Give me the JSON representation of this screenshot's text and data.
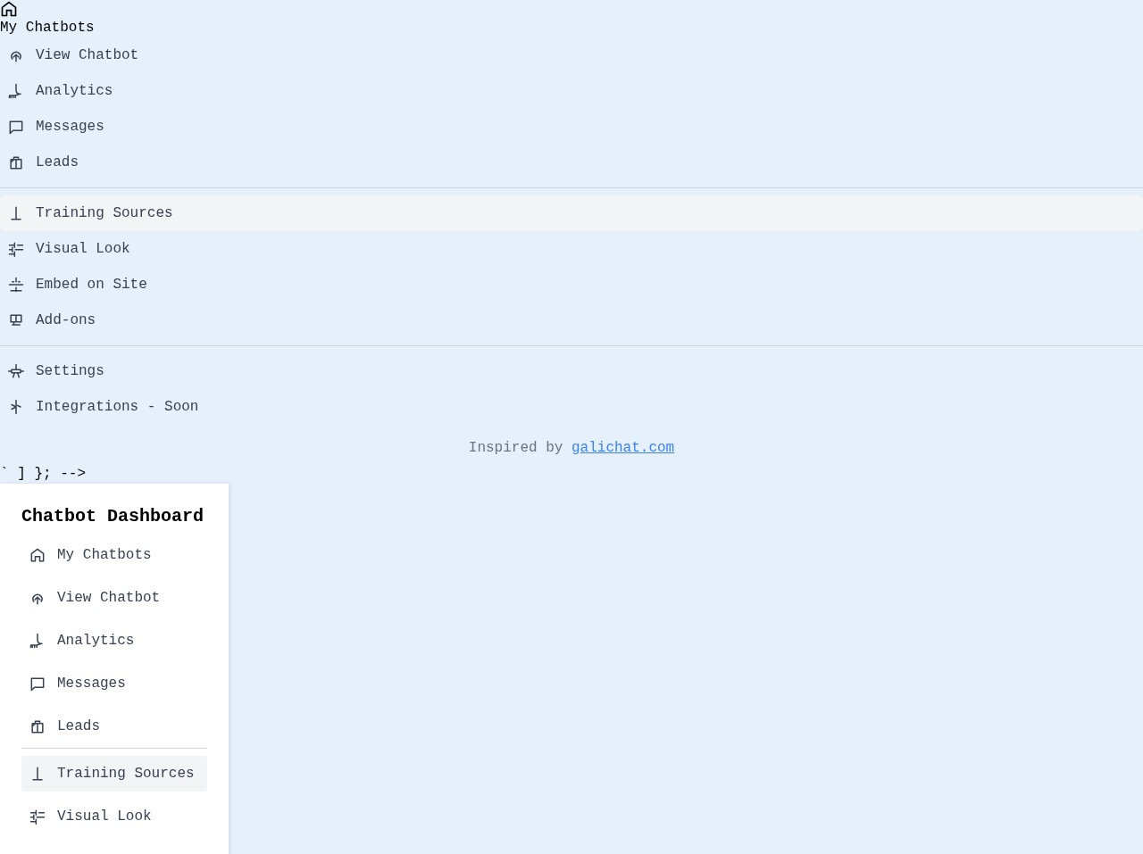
{
  "top_nav": {
    "home_label": "My Chatbots",
    "groups": [
      [
        {
          "label": "View Chatbot",
          "kind": "upload",
          "selected": false
        },
        {
          "label": "Analytics",
          "kind": "analytics",
          "selected": false
        },
        {
          "label": "Messages",
          "kind": "message",
          "selected": false
        },
        {
          "label": "Leads",
          "kind": "leads",
          "selected": false
        }
      ],
      [
        {
          "label": "Training Sources",
          "kind": "training",
          "selected": true
        },
        {
          "label": "Visual Look",
          "kind": "visual",
          "selected": false
        },
        {
          "label": "Embed on Site",
          "kind": "embed",
          "selected": false
        },
        {
          "label": "Add-ons",
          "kind": "addons",
          "selected": false
        }
      ],
      [
        {
          "label": "Settings",
          "kind": "settings",
          "selected": false
        },
        {
          "label": "Integrations - Soon",
          "kind": "integrations",
          "selected": false
        }
      ]
    ]
  },
  "footer": {
    "prefix": "Inspired by",
    "link": "galichat.com"
  },
  "stray_text": "` ] }; -->",
  "sidebar": {
    "title": "Chatbot Dashboard",
    "groups": [
      [
        {
          "label": "My Chatbots",
          "kind": "home",
          "selected": false
        },
        {
          "label": "View Chatbot",
          "kind": "upload",
          "selected": false
        },
        {
          "label": "Analytics",
          "kind": "analytics",
          "selected": false
        },
        {
          "label": "Messages",
          "kind": "message",
          "selected": false
        },
        {
          "label": "Leads",
          "kind": "leads",
          "selected": false
        }
      ],
      [
        {
          "label": "Training Sources",
          "kind": "training",
          "selected": true
        },
        {
          "label": "Visual Look",
          "kind": "visual",
          "selected": false
        }
      ]
    ]
  }
}
